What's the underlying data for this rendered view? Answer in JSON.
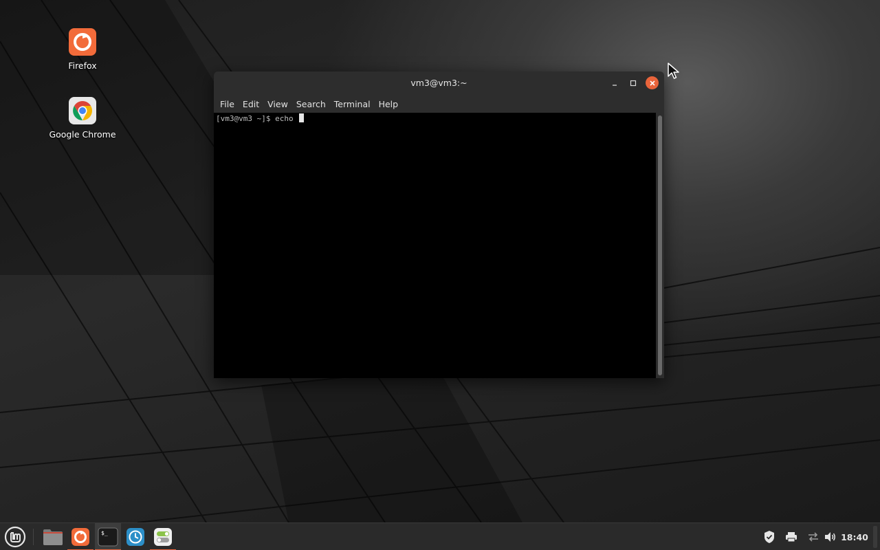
{
  "desktop": {
    "icons": [
      {
        "label": "Firefox",
        "icon": "firefox-icon"
      },
      {
        "label": "Google Chrome",
        "icon": "chrome-icon"
      }
    ]
  },
  "terminal": {
    "title": "vm3@vm3:~",
    "menu": [
      "File",
      "Edit",
      "View",
      "Search",
      "Terminal",
      "Help"
    ],
    "prompt": "[vm3@vm3 ~]$ echo ",
    "controls": {
      "minimize": "minimize-icon",
      "maximize": "maximize-icon",
      "close": "close-icon"
    }
  },
  "taskbar": {
    "menu_icon": "linux-mint-menu-icon",
    "apps": [
      {
        "name": "Files",
        "icon": "folder-icon",
        "active": false
      },
      {
        "name": "Firefox",
        "icon": "firefox-icon",
        "active": true
      },
      {
        "name": "Terminal",
        "icon": "terminal-icon",
        "active": true
      },
      {
        "name": "Timeshift",
        "icon": "clock-icon",
        "active": false
      },
      {
        "name": "Settings",
        "icon": "settings-toggle-icon",
        "active": true
      }
    ],
    "tray": [
      "shield-icon",
      "printer-icon",
      "network-icon",
      "volume-icon"
    ],
    "clock": "18:40"
  },
  "colors": {
    "accent": "#e9643b",
    "terminal_bg": "#000000",
    "taskbar_bg": "#2a2a2a"
  }
}
